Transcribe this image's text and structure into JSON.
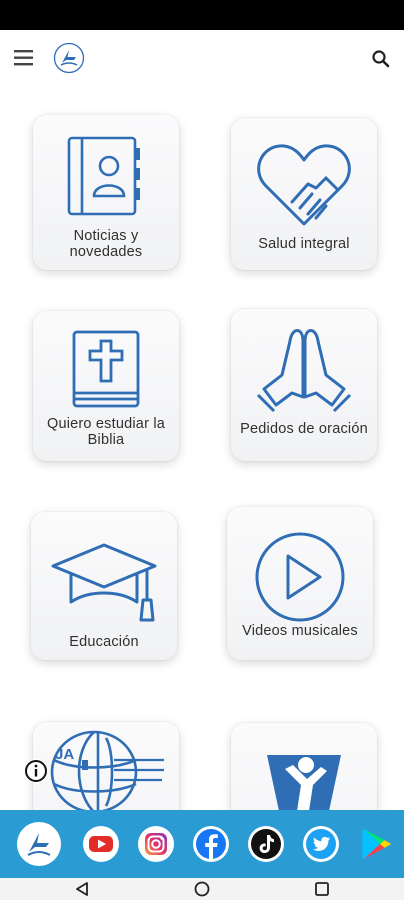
{
  "header": {
    "menu_icon": "hamburger-menu-icon",
    "logo_icon": "adventist-logo-icon",
    "search_icon": "search-icon"
  },
  "tiles": [
    {
      "label": "Noticias y novedades",
      "icon": "address-book-icon"
    },
    {
      "label": "Salud integral",
      "icon": "heart-handshake-icon"
    },
    {
      "label": "Quiero estudiar la Biblia",
      "icon": "bible-cross-icon"
    },
    {
      "label": "Pedidos de oración",
      "icon": "praying-hands-icon"
    },
    {
      "label": "Educación",
      "icon": "graduation-cap-icon"
    },
    {
      "label": "Videos musicales",
      "icon": "play-circle-icon"
    },
    {
      "label": "",
      "icon": "ja-globe-logo-icon",
      "badge": "JA"
    },
    {
      "label": "",
      "icon": "person-banner-icon"
    }
  ],
  "info_icon": "info-icon",
  "social": [
    {
      "icon": "adventist-logo-icon"
    },
    {
      "icon": "youtube-icon"
    },
    {
      "icon": "instagram-icon"
    },
    {
      "icon": "facebook-icon"
    },
    {
      "icon": "tiktok-icon"
    },
    {
      "icon": "twitter-icon"
    },
    {
      "icon": "google-play-icon"
    }
  ],
  "nav": [
    {
      "icon": "back-triangle-icon"
    },
    {
      "icon": "home-circle-icon"
    },
    {
      "icon": "recents-square-icon"
    }
  ],
  "colors": {
    "accent": "#2f6db5",
    "social_bar": "#2b9bd4"
  }
}
